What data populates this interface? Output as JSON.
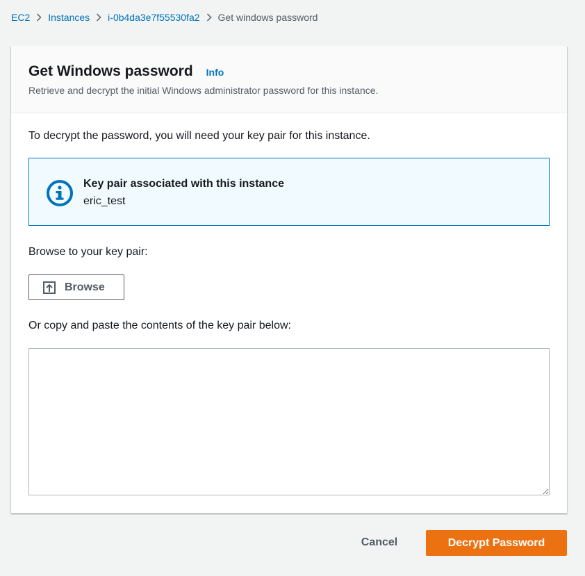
{
  "breadcrumb": {
    "items": [
      {
        "label": "EC2",
        "link": true
      },
      {
        "label": "Instances",
        "link": true
      },
      {
        "label": "i-0b4da3e7f55530fa2",
        "link": true
      },
      {
        "label": "Get windows password",
        "link": false
      }
    ],
    "separator_icon": "chevron-right-icon"
  },
  "panel": {
    "title": "Get Windows password",
    "info_label": "Info",
    "description": "Retrieve and decrypt the initial Windows administrator password for this instance.",
    "intro": "To decrypt the password, you will need your key pair for this instance."
  },
  "alert": {
    "icon": "info-icon",
    "title": "Key pair associated with this instance",
    "value": "eric_test"
  },
  "browse": {
    "label": "Browse to your key pair:",
    "button_label": "Browse",
    "icon": "upload-icon"
  },
  "paste": {
    "label": "Or copy and paste the contents of the key pair below:",
    "value": ""
  },
  "actions": {
    "cancel_label": "Cancel",
    "decrypt_label": "Decrypt Password"
  },
  "colors": {
    "link": "#0073bb",
    "primary_button": "#ec7211",
    "alert_background": "#f1faff",
    "alert_border": "#0073bb",
    "page_background": "#f2f3f3"
  }
}
